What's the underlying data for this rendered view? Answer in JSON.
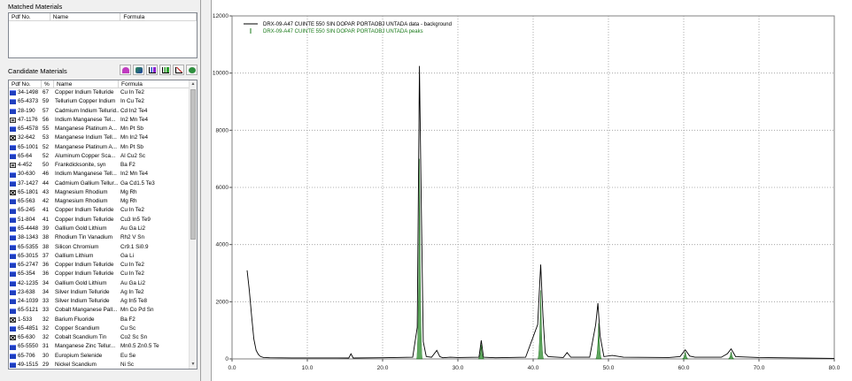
{
  "matched": {
    "title": "Matched Materials",
    "columns": [
      "Pdf No.",
      "Name",
      "Formula"
    ]
  },
  "candidate": {
    "title": "Candidate Materials",
    "columns": [
      "Pdf No.",
      "%",
      "Name",
      "Formula"
    ],
    "rows": [
      {
        "icon": "folder",
        "pdf": "34-1498",
        "pct": "67",
        "name": "Copper Indium Telluride",
        "formula": "Cu In Te2"
      },
      {
        "icon": "folder",
        "pdf": "65-4373",
        "pct": "59",
        "name": "Tellurium Copper Indium",
        "formula": "In Cu Te2"
      },
      {
        "icon": "folder",
        "pdf": "28-190",
        "pct": "57",
        "name": "Cadmium Indium Tellurid...",
        "formula": "Cd In2 Te4"
      },
      {
        "icon": "star",
        "pdf": "47-1176",
        "pct": "56",
        "name": "Indium Manganese Tel...",
        "formula": "In2 Mn Te4"
      },
      {
        "icon": "folder",
        "pdf": "65-4578",
        "pct": "55",
        "name": "Manganese Platinum A...",
        "formula": "Mn Pt Sb"
      },
      {
        "icon": "cross",
        "pdf": "32-642",
        "pct": "53",
        "name": "Manganese Indium Tell...",
        "formula": "Mn In2 Te4"
      },
      {
        "icon": "folder",
        "pdf": "65-1001",
        "pct": "52",
        "name": "Manganese Platinum A...",
        "formula": "Mn Pt Sb"
      },
      {
        "icon": "folder",
        "pdf": "65-64",
        "pct": "52",
        "name": "Aluminum Copper Sca...",
        "formula": "Al Cu2 Sc"
      },
      {
        "icon": "star",
        "pdf": "4-452",
        "pct": "50",
        "name": "Frankdicksonite, syn",
        "formula": "Ba F2"
      },
      {
        "icon": "folder",
        "pdf": "30-630",
        "pct": "46",
        "name": "Indium Manganese Tell...",
        "formula": "In2 Mn Te4"
      },
      {
        "icon": "folder",
        "pdf": "37-1427",
        "pct": "44",
        "name": "Cadmium Gallium Tellur...",
        "formula": "Ga Cd1.5 Te3"
      },
      {
        "icon": "cross",
        "pdf": "65-1801",
        "pct": "43",
        "name": "Magnesium Rhodium",
        "formula": "Mg Rh"
      },
      {
        "icon": "folder",
        "pdf": "65-563",
        "pct": "42",
        "name": "Magnesium Rhodium",
        "formula": "Mg Rh"
      },
      {
        "icon": "folder",
        "pdf": "65-245",
        "pct": "41",
        "name": "Copper Indium Telluride",
        "formula": "Cu In Te2"
      },
      {
        "icon": "folder",
        "pdf": "51-804",
        "pct": "41",
        "name": "Copper Indium Telluride",
        "formula": "Cu3 In5 Te9"
      },
      {
        "icon": "folder",
        "pdf": "65-4448",
        "pct": "39",
        "name": "Gallium Gold Lithium",
        "formula": "Au Ga Li2"
      },
      {
        "icon": "folder",
        "pdf": "38-1343",
        "pct": "38",
        "name": "Rhodium Tin Vanadium",
        "formula": "Rh2 V Sn"
      },
      {
        "icon": "folder",
        "pdf": "65-5355",
        "pct": "38",
        "name": "Silicon Chromium",
        "formula": "Cr9.1 Si0.9"
      },
      {
        "icon": "folder",
        "pdf": "65-3015",
        "pct": "37",
        "name": "Gallium Lithium",
        "formula": "Ga Li"
      },
      {
        "icon": "folder",
        "pdf": "65-2747",
        "pct": "36",
        "name": "Copper Indium Telluride",
        "formula": "Cu In Te2"
      },
      {
        "icon": "folder",
        "pdf": "65-354",
        "pct": "36",
        "name": "Copper Indium Telluride",
        "formula": "Cu In Te2"
      },
      {
        "icon": "folder",
        "pdf": "42-1235",
        "pct": "34",
        "name": "Gallium Gold Lithium",
        "formula": "Au Ga Li2"
      },
      {
        "icon": "folder",
        "pdf": "23-638",
        "pct": "34",
        "name": "Silver Indium Telluride",
        "formula": "Ag In Te2"
      },
      {
        "icon": "folder",
        "pdf": "24-1039",
        "pct": "33",
        "name": "Silver Indium Telluride",
        "formula": "Ag In5 Te8"
      },
      {
        "icon": "folder",
        "pdf": "65-5121",
        "pct": "33",
        "name": "Cobalt Manganese Pall...",
        "formula": "Mn Co Pd Sn"
      },
      {
        "icon": "cross",
        "pdf": "1-533",
        "pct": "32",
        "name": "Barium Fluoride",
        "formula": "Ba F2"
      },
      {
        "icon": "folder",
        "pdf": "65-4851",
        "pct": "32",
        "name": "Copper Scandium",
        "formula": "Cu Sc"
      },
      {
        "icon": "cross",
        "pdf": "65-630",
        "pct": "32",
        "name": "Cobalt Scandium Tin",
        "formula": "Co2 Sc Sn"
      },
      {
        "icon": "folder",
        "pdf": "65-5550",
        "pct": "31",
        "name": "Manganese Zinc Tellur...",
        "formula": "Mn0.5 Zn0.5 Te"
      },
      {
        "icon": "folder",
        "pdf": "65-706",
        "pct": "30",
        "name": "Europium Selenide",
        "formula": "Eu Se"
      },
      {
        "icon": "folder",
        "pdf": "49-1515",
        "pct": "29",
        "name": "Nickel Scandium",
        "formula": "Ni Sc"
      }
    ]
  },
  "toolbar": {
    "icons": [
      "pie-icon",
      "color-palette-icon",
      "bar-chart-icon",
      "bar-chart-green-icon",
      "line-chart-icon",
      "filter-icon"
    ]
  },
  "chart_data": {
    "type": "line",
    "xlim": [
      0,
      80
    ],
    "ylim": [
      0,
      12000
    ],
    "xticks": [
      "0.0",
      "10.0",
      "20.0",
      "30.0",
      "40.0",
      "50.0",
      "60.0",
      "70.0",
      "80.0"
    ],
    "yticks": [
      "0",
      "2000",
      "4000",
      "6000",
      "8000",
      "10000",
      "12000"
    ],
    "grid": true,
    "legend": [
      {
        "label": "DRX-09-A47 CUINTE 550 SIN DOPAR PORTAOBJ UNTADA data - background",
        "color": "#000000"
      },
      {
        "label": "DRX-09-A47 CUINTE 550 SIN DOPAR PORTAOBJ UNTADA peaks",
        "color": "#1a7a1a"
      }
    ],
    "data_series": {
      "name": "DRX-09-A47 CUINTE 550 SIN DOPAR PORTAOBJ UNTADA data - background",
      "x": [
        2.0,
        2.3,
        2.6,
        2.9,
        3.2,
        3.5,
        3.8,
        4.2,
        5.0,
        8.0,
        15.5,
        15.8,
        16.1,
        20.0,
        24.0,
        24.6,
        24.9,
        25.1,
        25.4,
        25.8,
        26.5,
        27.2,
        27.6,
        28.0,
        29.0,
        30.0,
        32.8,
        33.1,
        33.4,
        35.0,
        39.0,
        40.6,
        41.0,
        41.3,
        41.6,
        42.0,
        44.0,
        44.5,
        45.0,
        47.5,
        48.3,
        48.6,
        48.9,
        49.4,
        50.5,
        52.0,
        58.0,
        59.5,
        60.2,
        60.8,
        61.5,
        65.0,
        65.8,
        66.3,
        66.9,
        70.0,
        80.0
      ],
      "y": [
        3100,
        2400,
        1500,
        700,
        300,
        150,
        80,
        50,
        40,
        35,
        30,
        180,
        30,
        40,
        60,
        1100,
        10250,
        6000,
        600,
        80,
        60,
        300,
        80,
        40,
        60,
        50,
        60,
        650,
        60,
        40,
        60,
        1200,
        3300,
        1500,
        200,
        80,
        50,
        220,
        60,
        60,
        1200,
        1950,
        800,
        80,
        120,
        60,
        50,
        80,
        320,
        100,
        60,
        60,
        180,
        350,
        80,
        50,
        20
      ]
    },
    "peaks_series": {
      "name": "DRX-09-A47 CUINTE 550 SIN DOPAR PORTAOBJ UNTADA peaks",
      "x": [
        24.9,
        33.1,
        41.0,
        48.7,
        60.2,
        66.3
      ],
      "y": [
        7000,
        500,
        2400,
        1250,
        250,
        250
      ]
    }
  }
}
